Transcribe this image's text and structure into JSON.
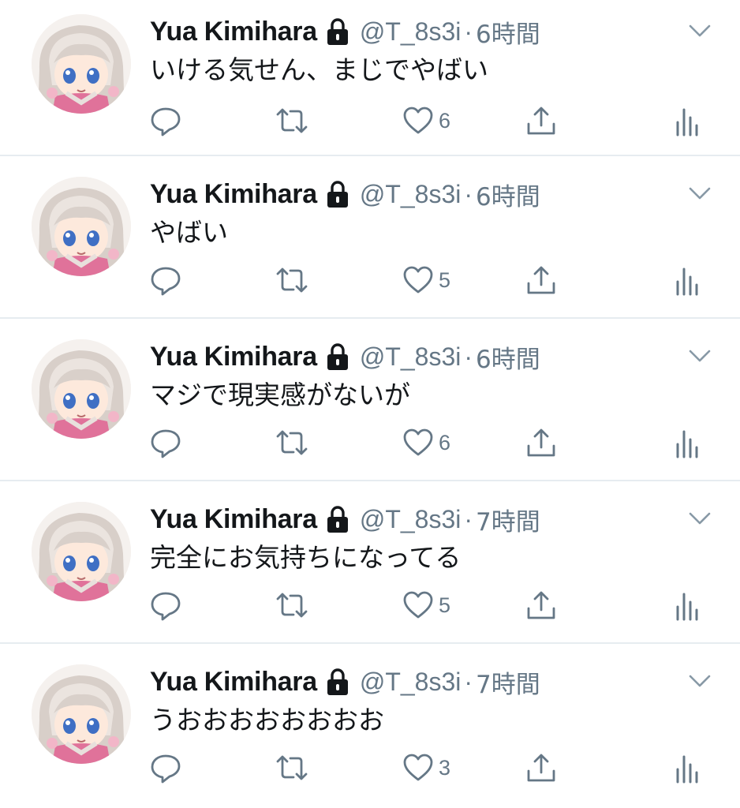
{
  "tweets": [
    {
      "name": "Yua Kimihara",
      "handle": "@T_8s3i",
      "separator": "·",
      "time": "6時間",
      "text": "いける気せん、まじでやばい",
      "likes": "6"
    },
    {
      "name": "Yua Kimihara",
      "handle": "@T_8s3i",
      "separator": "·",
      "time": "6時間",
      "text": "やばい",
      "likes": "5"
    },
    {
      "name": "Yua Kimihara",
      "handle": "@T_8s3i",
      "separator": "·",
      "time": "6時間",
      "text": "マジで現実感がないが",
      "likes": "6"
    },
    {
      "name": "Yua Kimihara",
      "handle": "@T_8s3i",
      "separator": "·",
      "time": "7時間",
      "text": "完全にお気持ちになってる",
      "likes": "5"
    },
    {
      "name": "Yua Kimihara",
      "handle": "@T_8s3i",
      "separator": "·",
      "time": "7時間",
      "text": "うおおおおおおおお",
      "likes": "3"
    }
  ],
  "icons": {
    "lock": "lock-icon",
    "caret": "chevron-down-icon",
    "reply": "reply-icon",
    "retweet": "retweet-icon",
    "like": "heart-icon",
    "share": "share-icon",
    "stats": "analytics-icon"
  },
  "colors": {
    "text_primary": "#14171a",
    "text_secondary": "#657786",
    "divider": "#e6ecf0",
    "background": "#ffffff"
  }
}
